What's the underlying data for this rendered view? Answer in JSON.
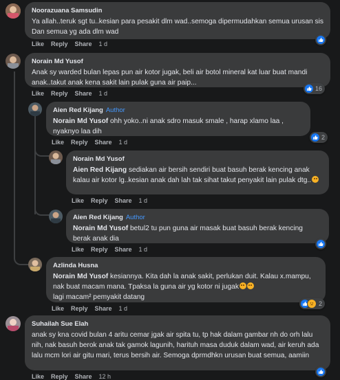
{
  "actions": {
    "like": "Like",
    "reply": "Reply",
    "share": "Share"
  },
  "comments": [
    {
      "author": "Noorazuana Samsudin",
      "text": "Ya allah..teruk sgt tu..kesian para pesakit dlm wad..semoga dipermudahkan semua urusan sis Dan semua yg ada dlm wad",
      "time": "1 d",
      "reactions": ""
    },
    {
      "author": "Norain Md Yusof",
      "text": "Anak sy warded bulan lepas pun air kotor jugak, beli air botol mineral kat luar buat mandi anak..takut anak kena sakit lain pulak guna air paip...",
      "time": "1 d",
      "reactions": "16"
    },
    {
      "author": "Aien Red Kijang",
      "badge": "Author",
      "mention": "Norain Md Yusof",
      "text": " ohh yoko..ni anak sdro masuk smale , harap xlamo laa , nyaknyo laa dih",
      "time": "1 d",
      "reactions": "2"
    },
    {
      "author": "Norain Md Yusof",
      "mention": "Aien Red Kijang",
      "text": " sediakan air bersih sendiri buat basuh berak kencing anak kalau air kotor lg..kesian anak dah lah tak sihat takut penyakit lain pulak dtg..",
      "time": "1 d",
      "reactions": ""
    },
    {
      "author": "Aien Red Kijang",
      "badge": "Author",
      "mention": "Norain Md Yusof",
      "text": " betul2 tu pun guna air masak buat basuh berak kencing berak anak dia",
      "time": "1 d",
      "reactions": ""
    },
    {
      "author": "Azlinda Husna",
      "mention": "Norain Md Yusof",
      "text": " kesiannya. Kita dah la anak sakit, perlukan duit. Kalau x.mampu, nak buat macam mana. Tpaksa la guna air yg kotor ni jugak",
      "text2": "lagi macam² pemyakit datang",
      "time": "1 d",
      "reactions": "2"
    },
    {
      "author": "Suhailah Sue Elah",
      "text": "anak sy kna covid bulan 4 aritu cemar jgak air spita tu, tp hak dalam gambar nh do orh lalu nih, nak basuh berok anak tak gamok lagunih, harituh masa duduk dalam wad, air keruh ada lalu mcm lori air gitu mari, terus bersih air. Semoga dprmdhkn urusan buat semua, aamiin",
      "time": "12 h",
      "reactions": ""
    }
  ]
}
